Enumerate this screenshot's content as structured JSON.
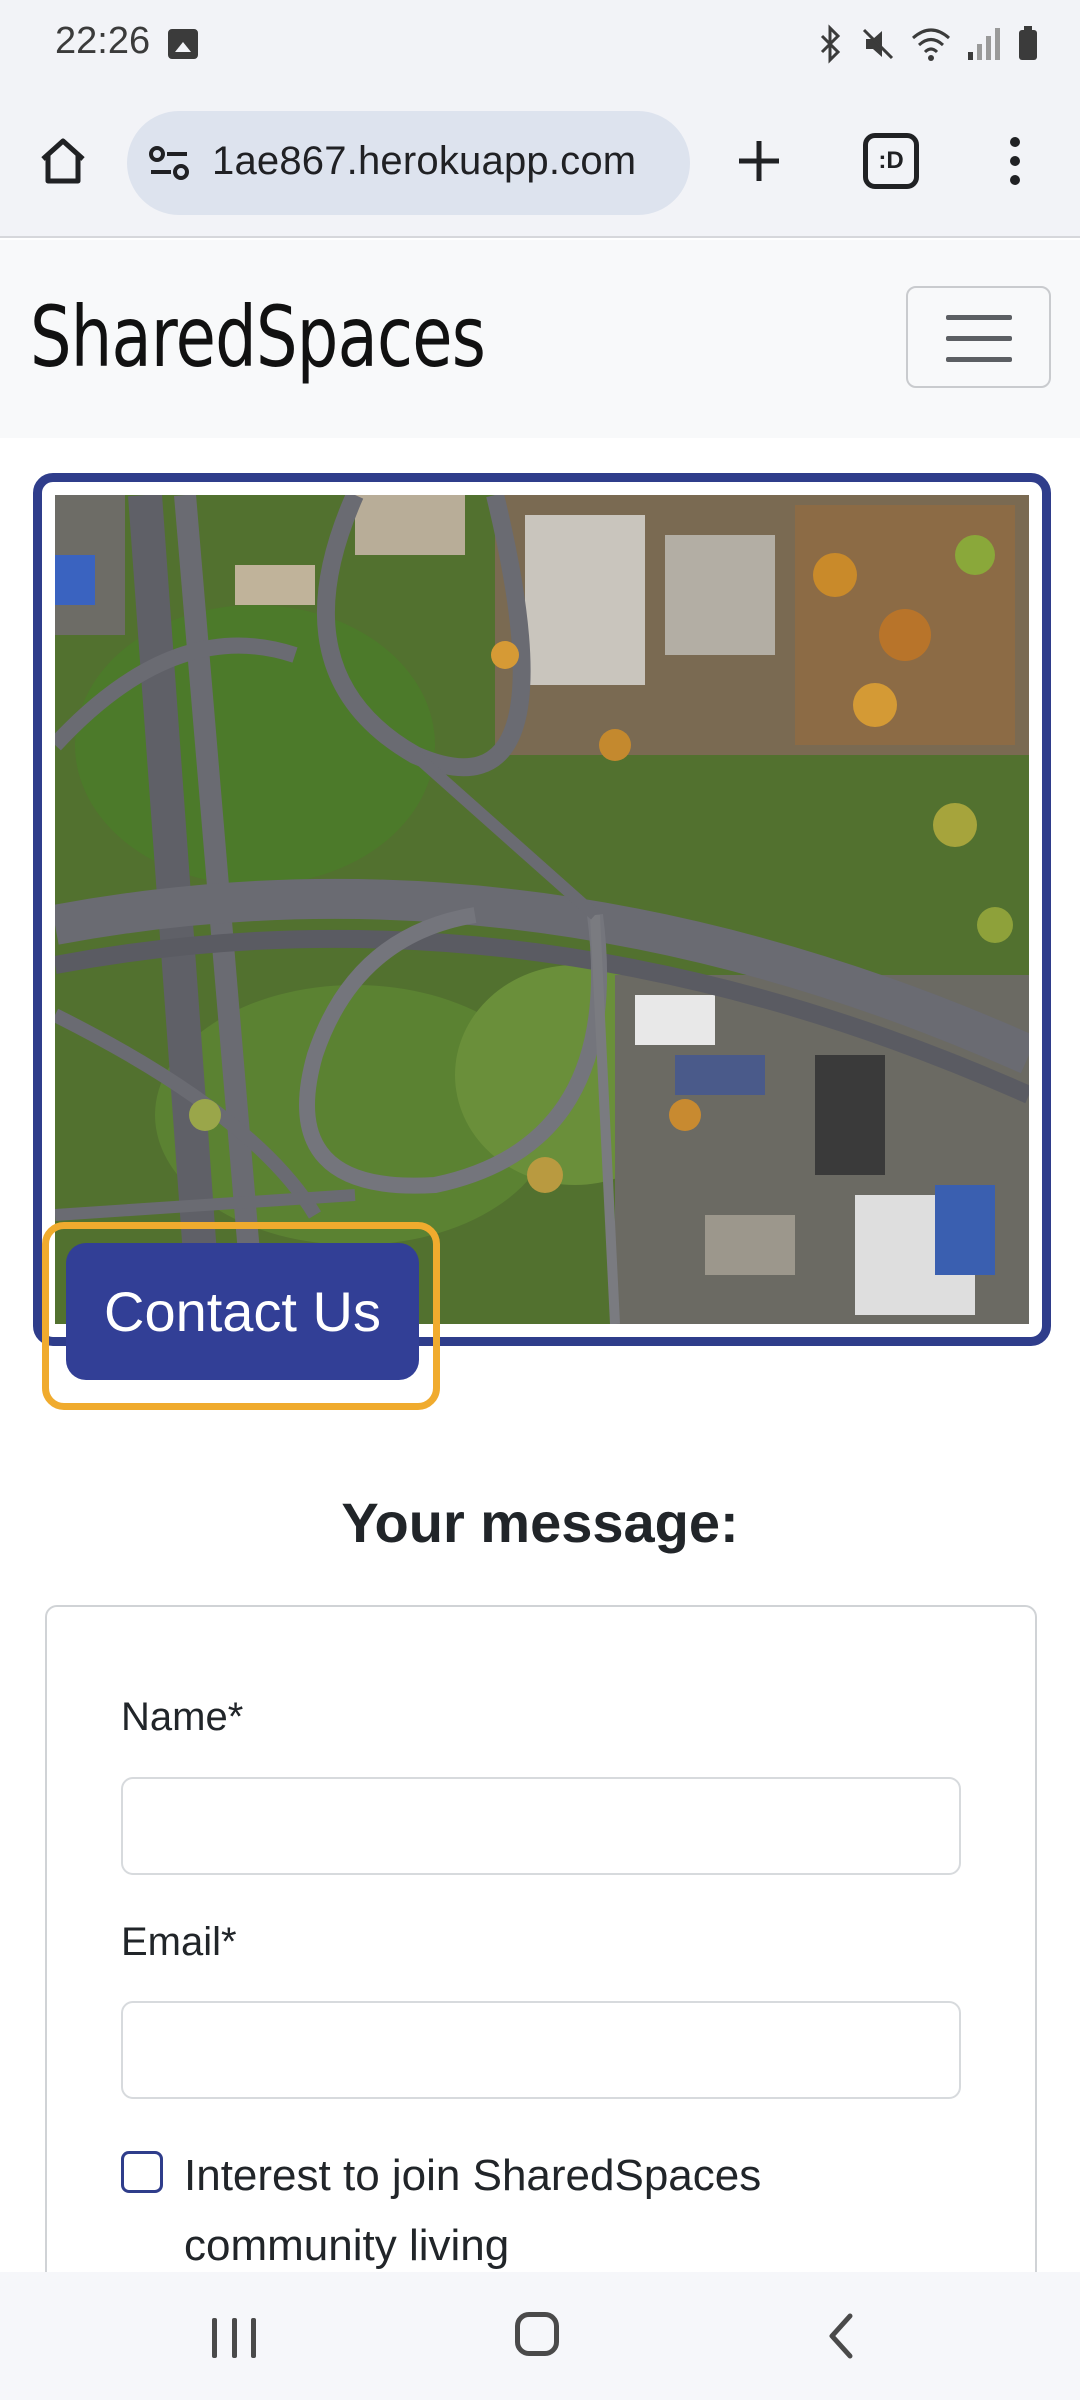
{
  "status_bar": {
    "time": "22:26",
    "icons": [
      "image-icon",
      "bluetooth-icon",
      "mute-icon",
      "wifi-icon",
      "signal-icon",
      "battery-icon"
    ]
  },
  "browser": {
    "url": "1ae867.herokuapp.com",
    "tabs_label": ":D",
    "icons": [
      "home-icon",
      "site-settings-icon",
      "plus-icon",
      "tabs-icon",
      "more-vert-icon"
    ]
  },
  "site": {
    "brand": "SharedSpaces",
    "toggler_icon": "hamburger-icon",
    "hero": {
      "image_subject": "aerial view of highway interchange",
      "contact_button": "Contact Us",
      "accent_color": "#2f3d8b",
      "focus_ring_color": "#f0ab2e"
    },
    "form": {
      "heading": "Your message:",
      "name_label": "Name*",
      "email_label": "Email*",
      "name_value": "",
      "email_value": "",
      "checkbox_label": "Interest to join SharedSpaces community living",
      "checkbox_checked": false
    }
  },
  "system_nav": {
    "icons": [
      "recents-icon",
      "home-circle-icon",
      "back-icon"
    ]
  }
}
